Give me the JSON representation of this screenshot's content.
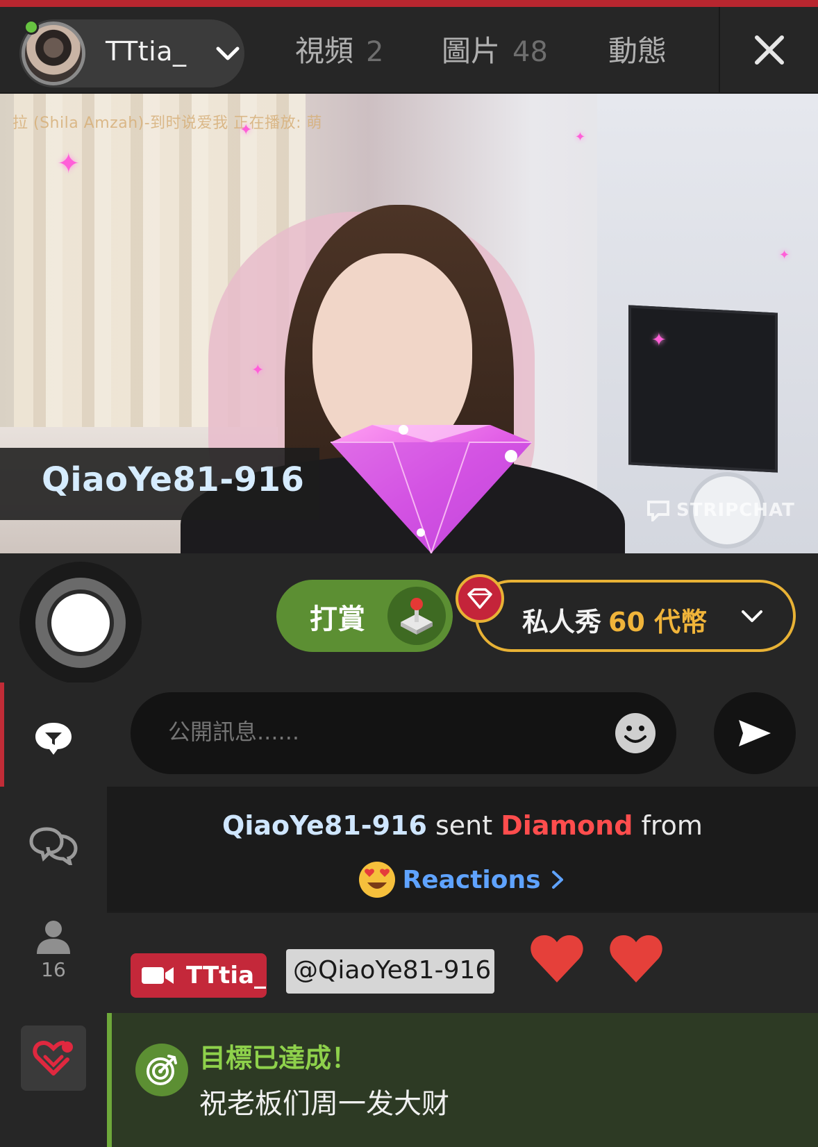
{
  "header": {
    "username": "TTtia_",
    "tabs": [
      {
        "label": "視頻",
        "count": "2"
      },
      {
        "label": "圖片",
        "count": "48"
      },
      {
        "label": "動態",
        "count": ""
      }
    ]
  },
  "video": {
    "overlay_text": "拉 (Shila Amzah)-到时说爱我  正在播放: 萌",
    "gift_sender": "QiaoYe81-916",
    "watermark": "STRIPCHAT"
  },
  "controls": {
    "tip_label": "打賞",
    "private_label": "私人秀",
    "private_price": "60 代幣"
  },
  "sidebar": {
    "user_count": "16"
  },
  "chat": {
    "input_placeholder": "公開訊息......",
    "gift_message": {
      "user": "QiaoYe81-916",
      "sent": "sent",
      "gift": "Diamond",
      "from": "from",
      "reactions_label": "Reactions"
    },
    "mention_message": {
      "model": "TTtia_",
      "mention": "@QiaoYe81-916"
    },
    "goal_message": {
      "title": "目標已達成！",
      "text": "祝老板们周一发大财"
    }
  },
  "colors": {
    "accent_red": "#c4283a",
    "tip_green": "#5c8f33",
    "private_gold": "#e8b235",
    "link_blue": "#5fa3ff"
  },
  "icons": [
    "chevron-down-icon",
    "close-icon",
    "joystick-icon",
    "diamond-icon",
    "chat-icon",
    "private-chat-icon",
    "user-icon",
    "heart-favorite-icon",
    "smiley-icon",
    "send-icon",
    "heart-eyes-emoji-icon",
    "chevron-right-icon",
    "video-camera-icon",
    "heart-icon",
    "target-icon"
  ]
}
